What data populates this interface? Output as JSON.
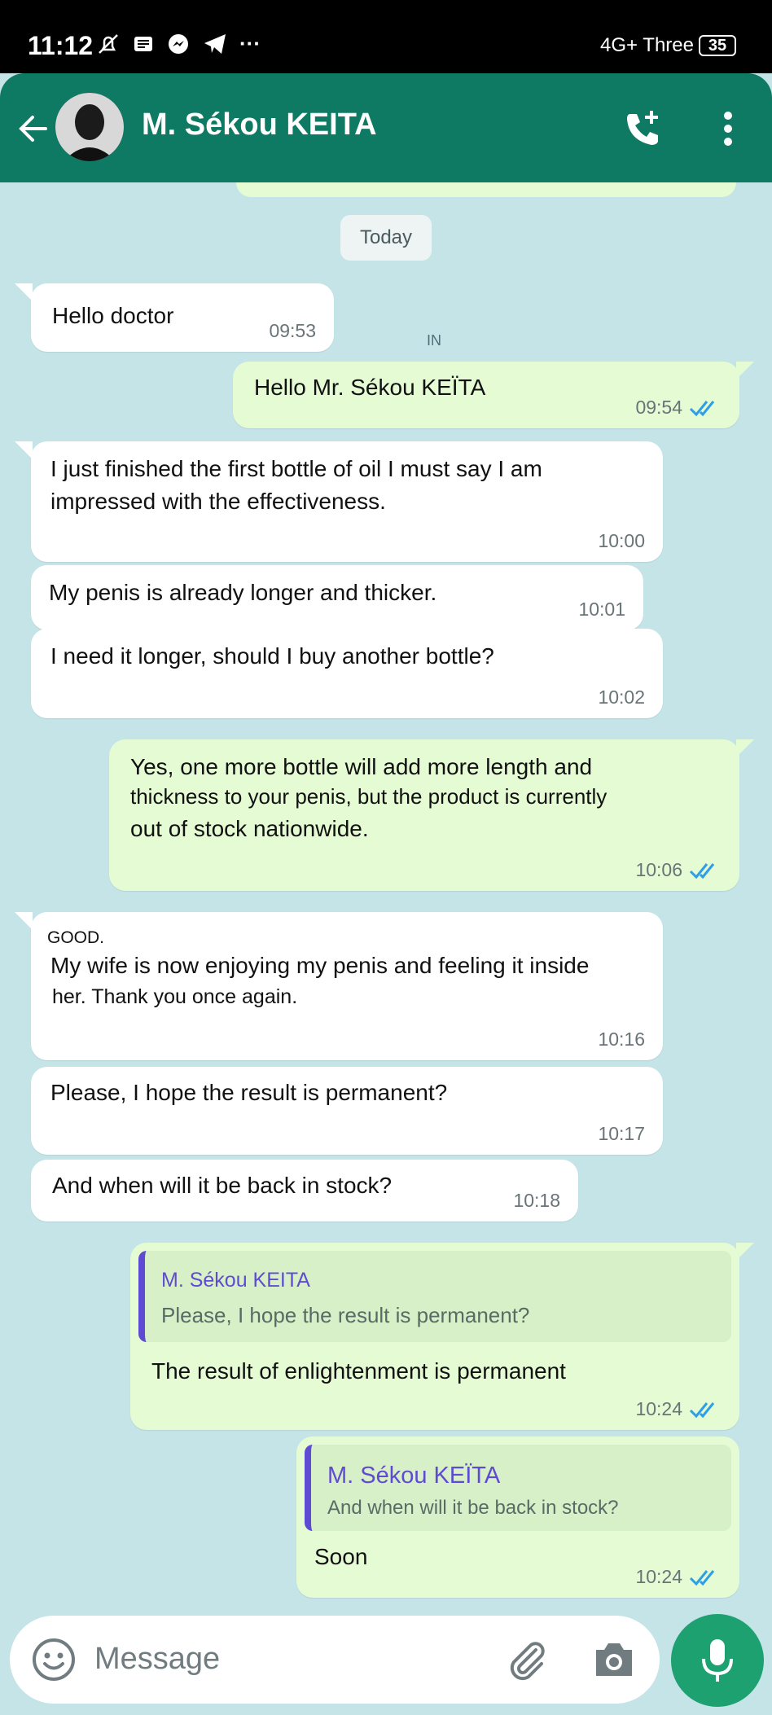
{
  "status_bar": {
    "time": "11:12",
    "network": "4G+ Three",
    "battery": "35",
    "more": "···"
  },
  "header": {
    "contact_name": "M. Sékou KEITA"
  },
  "chat": {
    "date_chip": "Today",
    "in_mark": "IN",
    "messages": [
      {
        "text": "Hello doctor",
        "time": "09:53"
      },
      {
        "text": "Hello Mr. Sékou KEÏTA",
        "time": "09:54"
      },
      {
        "line1": "I just finished the first bottle of oil I must say I am",
        "line2": "impressed with the effectiveness.",
        "time": "10:00"
      },
      {
        "text": "My penis is already longer and thicker.",
        "time": "10:01"
      },
      {
        "text": "I need it longer, should I buy another bottle?",
        "time": "10:02"
      },
      {
        "line1": "Yes, one more bottle will add more length and",
        "line2": "thickness to your penis, but the product is currently",
        "line3": "out of stock nationwide.",
        "time": "10:06"
      },
      {
        "label": "GOOD.",
        "line1": "My wife is now enjoying my penis and feeling it inside",
        "line2": "her. Thank you once again.",
        "time": "10:16"
      },
      {
        "text": "Please, I hope the result is permanent?",
        "time": "10:17"
      },
      {
        "text": "And when will it be back in stock?",
        "time": "10:18"
      },
      {
        "quote_author": "M. Sékou KEITA",
        "quote_text": "Please, I hope the result is permanent?",
        "text": "The result of enlightenment is permanent",
        "time": "10:24"
      },
      {
        "quote_author": "M.  Sékou KEÏTA",
        "quote_text": "And when will it be back in stock?",
        "text": "Soon",
        "time": "10:24"
      }
    ]
  },
  "composer": {
    "placeholder": "Message"
  },
  "colors": {
    "header": "#0f7a63",
    "outgoing_bubble": "#e4fbd4",
    "incoming_bubble": "#ffffff",
    "chat_background": "#c4e4e7",
    "mic_button": "#1ea170",
    "read_ticks": "#2e9fe6",
    "quote_accent": "#5f4bd3"
  },
  "icons": [
    "bell-off-icon",
    "news-icon",
    "messenger-icon",
    "telegram-icon",
    "back-arrow-icon",
    "call-add-icon",
    "more-vert-icon",
    "emoji-icon",
    "attach-icon",
    "camera-icon",
    "mic-icon",
    "double-check-icon"
  ]
}
